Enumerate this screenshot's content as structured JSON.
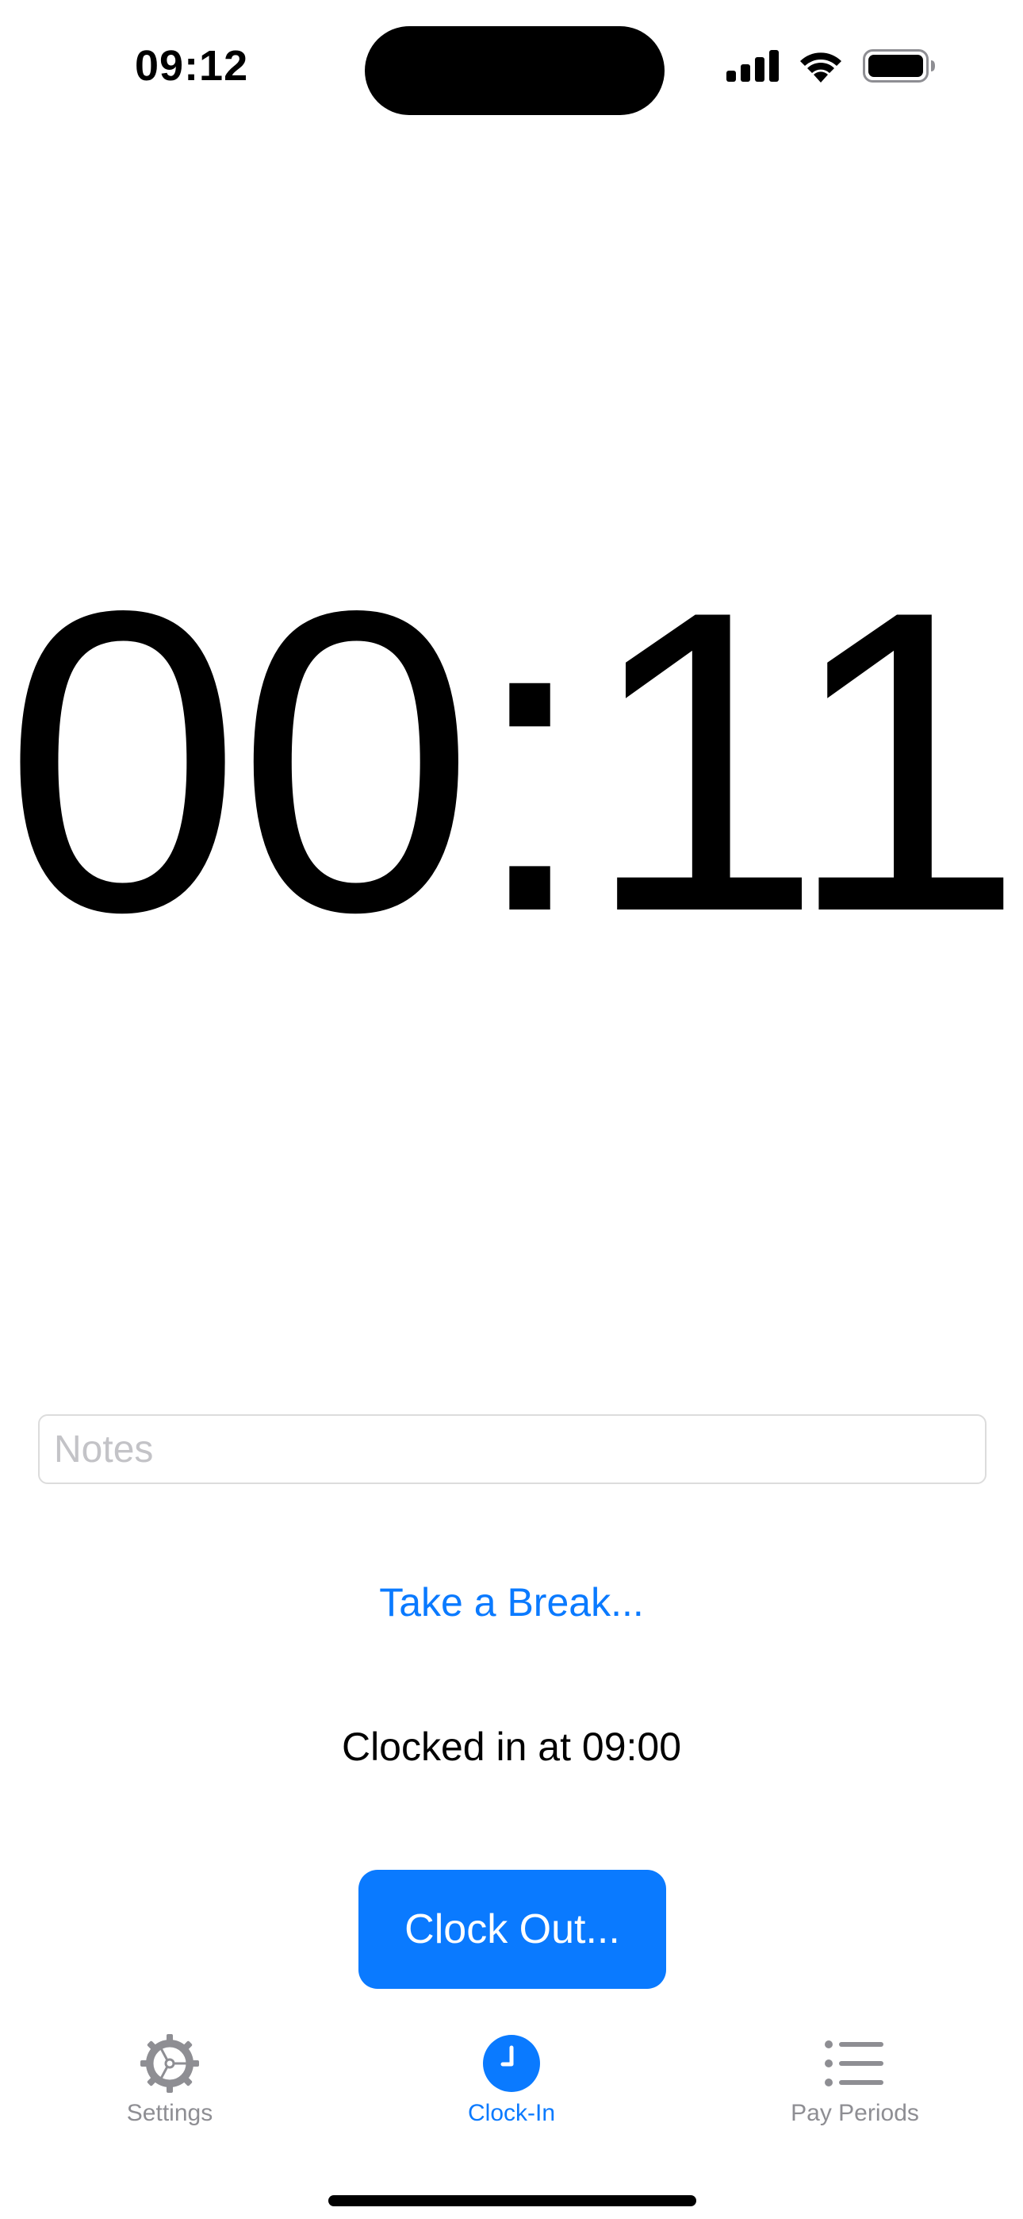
{
  "status_bar": {
    "time": "09:12"
  },
  "timer": {
    "display": "00:11"
  },
  "notes": {
    "placeholder": "Notes",
    "value": ""
  },
  "actions": {
    "break_label": "Take a Break...",
    "clocked_in_text": "Clocked in at 09:00",
    "clock_out_label": "Clock Out..."
  },
  "tab_bar": {
    "tabs": [
      {
        "label": "Settings",
        "icon": "gear-icon",
        "active": false
      },
      {
        "label": "Clock-In",
        "icon": "clock-icon",
        "active": true
      },
      {
        "label": "Pay Periods",
        "icon": "list-icon",
        "active": false
      }
    ]
  },
  "colors": {
    "accent": "#0a7aff",
    "inactive_tab": "#8e8e93",
    "placeholder": "#c3c3c7"
  }
}
